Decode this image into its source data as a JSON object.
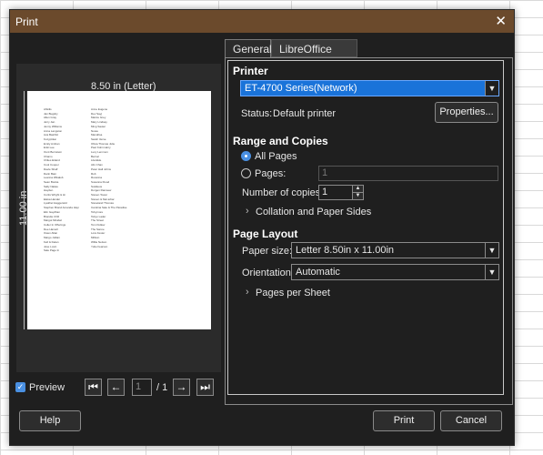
{
  "dialog": {
    "title": "Print"
  },
  "preview": {
    "width_label": "8.50 in (Letter)",
    "height_label": "11.00 in",
    "checkbox_label": "Preview",
    "page_current": "1",
    "page_total": "/ 1"
  },
  "tabs": {
    "general": "General",
    "calc": "LibreOffice Calc"
  },
  "printer": {
    "section": "Printer",
    "selected": "ET-4700 Series(Network)",
    "status_label": "Status:",
    "status_value": "Default printer",
    "properties_button": "Properties..."
  },
  "range": {
    "section": "Range and Copies",
    "all_pages": "All Pages",
    "pages": "Pages:",
    "pages_value": "1",
    "copies_label": "Number of copies:",
    "copies_value": "1",
    "collation": "Collation and Paper Sides"
  },
  "layout": {
    "section": "Page Layout",
    "paper_size_label": "Paper size:",
    "paper_size_value": "Letter 8.50in x 11.00in",
    "orientation_label": "Orientation:",
    "orientation_value": "Automatic",
    "pages_per_sheet": "Pages per Sheet"
  },
  "buttons": {
    "help": "Help",
    "print": "Print",
    "cancel": "Cancel"
  },
  "colors": {
    "titlebar": "#6b4a2c",
    "dialog_bg": "#1f1f1f",
    "accent": "#1a73d9"
  },
  "icons": {
    "close": "close-icon",
    "first": "first-page-icon",
    "prev": "previous-page-icon",
    "next": "next-page-icon",
    "last": "last-page-icon",
    "dropdown": "chevron-down-icon",
    "expander": "chevron-right-icon"
  }
}
